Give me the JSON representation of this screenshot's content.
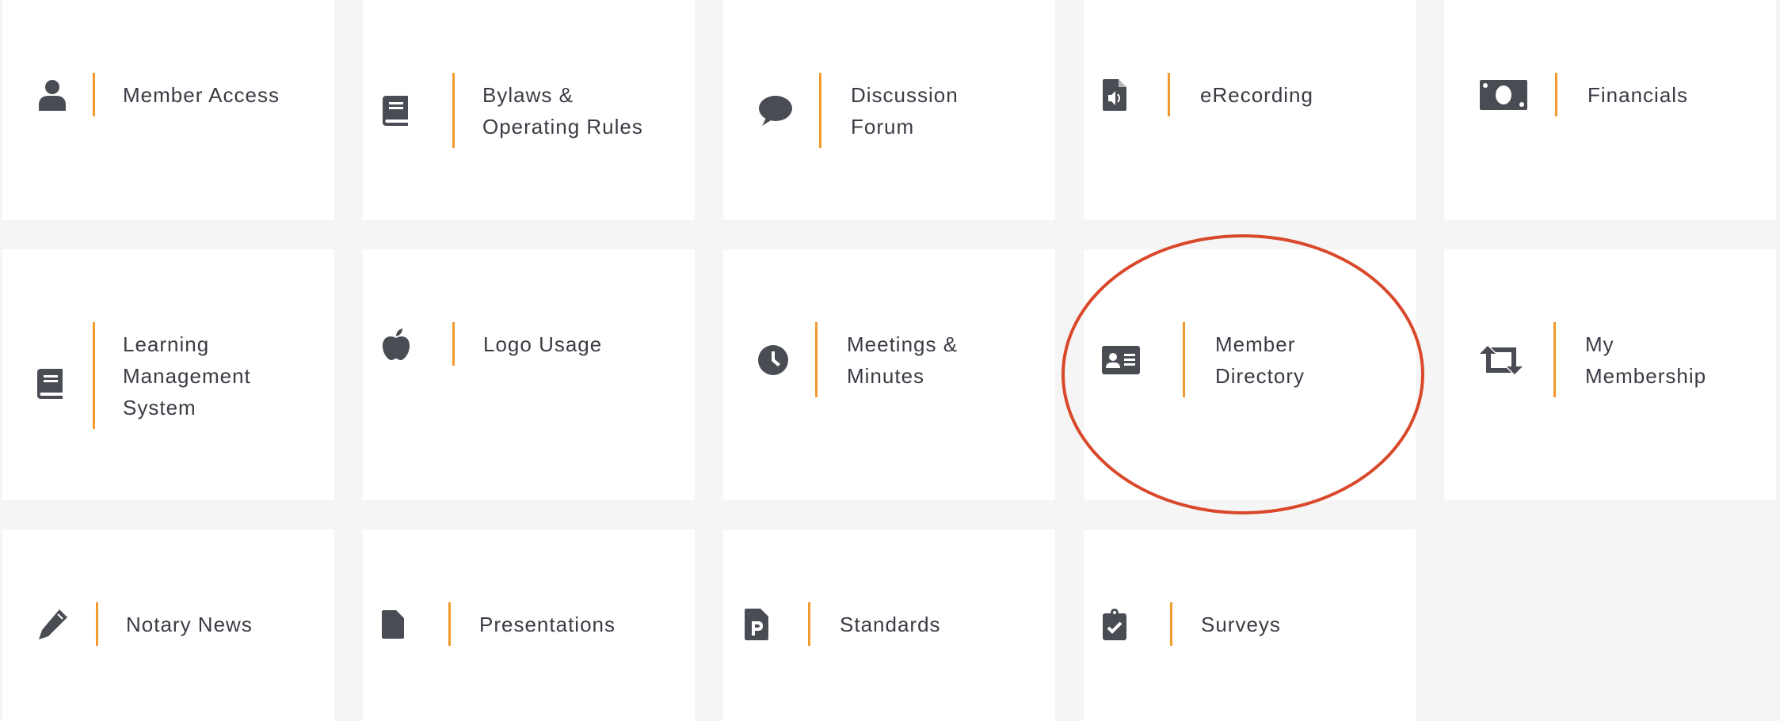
{
  "accent_color": "#f29a2e",
  "highlight_color": "#d9482a",
  "tiles": [
    {
      "icon": "user-icon",
      "lines": [
        "Member Access"
      ]
    },
    {
      "icon": "book-icon",
      "lines": [
        "Bylaws &",
        "Operating Rules"
      ]
    },
    {
      "icon": "comment-icon",
      "lines": [
        "Discussion",
        "Forum"
      ]
    },
    {
      "icon": "audio-file-icon",
      "lines": [
        "eRecording"
      ]
    },
    {
      "icon": "money-bill-icon",
      "lines": [
        "Financials"
      ]
    },
    {
      "icon": "book-icon",
      "lines": [
        "Learning",
        "Management",
        "System"
      ]
    },
    {
      "icon": "apple-icon",
      "lines": [
        "Logo Usage"
      ]
    },
    {
      "icon": "clock-icon",
      "lines": [
        "Meetings &",
        "Minutes"
      ]
    },
    {
      "icon": "id-card-icon",
      "lines": [
        "Member",
        "Directory"
      ],
      "highlighted": true
    },
    {
      "icon": "retweet-icon",
      "lines": [
        "My",
        "Membership"
      ]
    },
    {
      "icon": "pencil-icon",
      "lines": [
        "Notary News"
      ]
    },
    {
      "icon": "file-icon",
      "lines": [
        "Presentations"
      ]
    },
    {
      "icon": "file-p-icon",
      "lines": [
        "Standards"
      ]
    },
    {
      "icon": "clipboard-check-icon",
      "lines": [
        "Surveys"
      ]
    }
  ]
}
